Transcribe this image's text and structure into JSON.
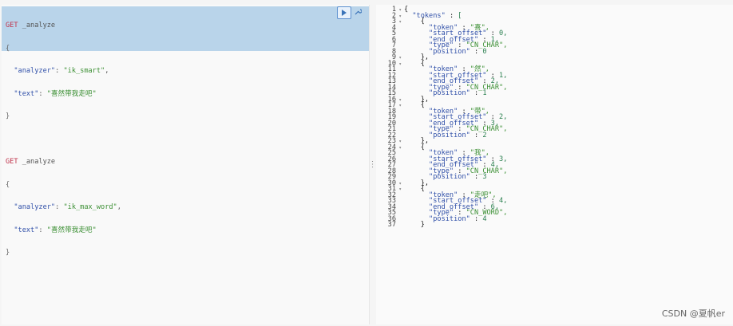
{
  "left_editor": {
    "line1": {
      "method": "GET",
      "path": " _analyze"
    },
    "line2": "{",
    "line3": {
      "key": "\"analyzer\"",
      "sep": ": ",
      "val": "\"ik_smart\"",
      "end": ","
    },
    "line4": {
      "key": "\"text\"",
      "sep": ": ",
      "val": "\"喜然带我走吧\"",
      "end": ""
    },
    "line5": "}",
    "line7": {
      "method": "GET",
      "path": " _analyze"
    },
    "line8": "{",
    "line9": {
      "key": "\"analyzer\"",
      "sep": ": ",
      "val": "\"ik_max_word\"",
      "end": ","
    },
    "line10": {
      "key": "\"text\"",
      "sep": ": ",
      "val": "\"喜然带我走吧\"",
      "end": ""
    },
    "line11": "}",
    "play_icon": "play-icon",
    "wrench_icon": "wrench-icon"
  },
  "right_output": {
    "line_numbers": [
      "1",
      "2",
      "3",
      "4",
      "5",
      "6",
      "7",
      "8",
      "9",
      "10",
      "11",
      "12",
      "13",
      "14",
      "15",
      "16",
      "17",
      "18",
      "19",
      "20",
      "21",
      "22",
      "23",
      "24",
      "25",
      "26",
      "27",
      "28",
      "29",
      "30",
      "31",
      "32",
      "33",
      "34",
      "35",
      "36",
      "37"
    ],
    "lines": [
      "{",
      "  \"tokens\" : [",
      "    {",
      "      \"token\" : \"喜\",",
      "      \"start_offset\" : 0,",
      "      \"end_offset\" : 1,",
      "      \"type\" : \"CN_CHAR\",",
      "      \"position\" : 0",
      "    },",
      "    {",
      "      \"token\" : \"然\",",
      "      \"start_offset\" : 1,",
      "      \"end_offset\" : 2,",
      "      \"type\" : \"CN_CHAR\",",
      "      \"position\" : 1",
      "    },",
      "    {",
      "      \"token\" : \"带\",",
      "      \"start_offset\" : 2,",
      "      \"end_offset\" : 3,",
      "      \"type\" : \"CN_CHAR\",",
      "      \"position\" : 2",
      "    },",
      "    {",
      "      \"token\" : \"我\",",
      "      \"start_offset\" : 3,",
      "      \"end_offset\" : 4,",
      "      \"type\" : \"CN_CHAR\",",
      "      \"position\" : 3",
      "    },",
      "    {",
      "      \"token\" : \"走吧\",",
      "      \"start_offset\" : 4,",
      "      \"end_offset\" : 6,",
      "      \"type\" : \"CN_WORD\",",
      "      \"position\" : 4",
      "    }"
    ],
    "fold_lines": [
      "1",
      "2",
      "3",
      "9",
      "10",
      "16",
      "17",
      "23",
      "24",
      "30",
      "31"
    ]
  },
  "resizer_icon": "drag-handle-icon",
  "watermark": "CSDN @夏帆er"
}
